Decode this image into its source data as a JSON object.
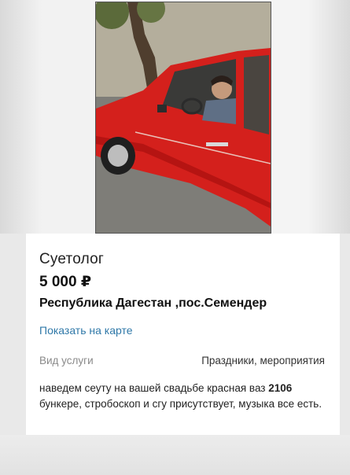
{
  "listing": {
    "title": "Суетолог",
    "price": "5 000 ₽",
    "location": "Республика Дагестан ,пос.Семендер",
    "map_link": "Показать на карте",
    "service_label": "Вид услуги",
    "service_value": "Праздники, мероприятия",
    "desc_part1": "наведем сеуту на вашей свадьбе",
    "desc_part2": "красная ваз",
    "desc_num": "2106",
    "desc_part3": "бункере, стробоскоп и сгу присутствует, музыка все есть."
  },
  "photo": {
    "subject": "red-lada-2106-with-driver",
    "car_color": "#d4201c"
  }
}
